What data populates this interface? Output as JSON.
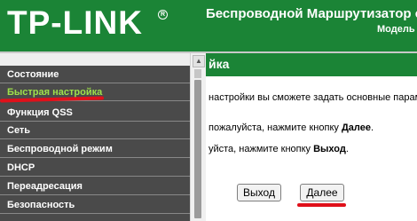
{
  "header": {
    "logo": "TP-LINK",
    "logo_mark": "R",
    "title": "Беспроводной Маршрутизатор серии",
    "model": "Модель"
  },
  "sidebar": {
    "items": [
      {
        "label": "Состояние"
      },
      {
        "label": "Быстрая настройка",
        "active": true
      },
      {
        "label": "Функция QSS"
      },
      {
        "label": "Сеть"
      },
      {
        "label": "Беспроводной режим"
      },
      {
        "label": "DHCP"
      },
      {
        "label": "Переадресация"
      },
      {
        "label": "Безопасность"
      }
    ]
  },
  "content": {
    "title": "йка",
    "line1": "настройки вы сможете задать основные парам",
    "line2_pre": "пожалуйста, нажмите кнопку ",
    "line2_bold": "Далее",
    "line2_post": ".",
    "line3_pre": "уйста, нажмите кнопку ",
    "line3_bold": "Выход",
    "line3_post": ".",
    "exit_button": "Выход",
    "next_button": "Далее"
  },
  "colors": {
    "header_green": "#1b8436",
    "sidebar_bg": "#4a4a4a",
    "active_item": "#9ee04a",
    "highlight_red": "#e0101a"
  }
}
